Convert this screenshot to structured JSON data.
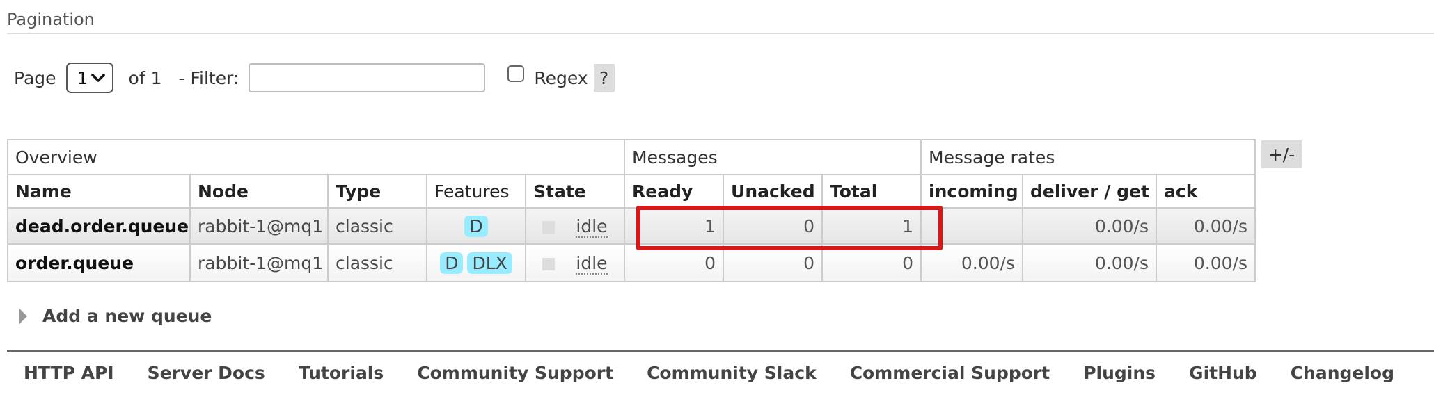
{
  "pagination": {
    "title": "Pagination",
    "page_label": "Page",
    "page_value": "1",
    "of_label": "of 1",
    "filter_label": "- Filter:",
    "filter_value": "",
    "regex_label": "Regex",
    "regex_checked": false,
    "help_label": "?"
  },
  "table": {
    "toggle_label": "+/-",
    "groups": [
      "Overview",
      "Messages",
      "Message rates"
    ],
    "columns": [
      "Name",
      "Node",
      "Type",
      "Features",
      "State",
      "Ready",
      "Unacked",
      "Total",
      "incoming",
      "deliver / get",
      "ack"
    ],
    "rows": [
      {
        "name": "dead.order.queue",
        "node": "rabbit-1@mq1",
        "type": "classic",
        "features": [
          "D"
        ],
        "state": "idle",
        "ready": "1",
        "unacked": "0",
        "total": "1",
        "incoming": "",
        "deliver_get": "0.00/s",
        "ack": "0.00/s"
      },
      {
        "name": "order.queue",
        "node": "rabbit-1@mq1",
        "type": "classic",
        "features": [
          "D",
          "DLX"
        ],
        "state": "idle",
        "ready": "0",
        "unacked": "0",
        "total": "0",
        "incoming": "0.00/s",
        "deliver_get": "0.00/s",
        "ack": "0.00/s"
      }
    ]
  },
  "add_queue": {
    "label": "Add a new queue"
  },
  "footer": {
    "links": [
      "HTTP API",
      "Server Docs",
      "Tutorials",
      "Community Support",
      "Community Slack",
      "Commercial Support",
      "Plugins",
      "GitHub",
      "Changelog"
    ]
  },
  "colors": {
    "feature_badge": "#99ebff",
    "highlight_border": "#d3191c",
    "border": "#cccccc"
  }
}
